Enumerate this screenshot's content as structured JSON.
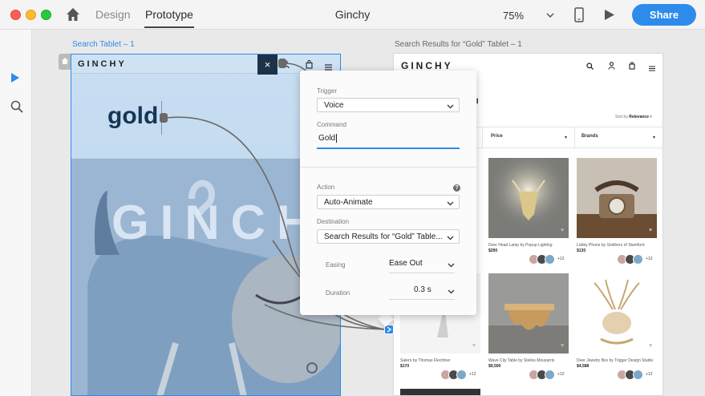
{
  "window": {
    "tabs": [
      {
        "label": "Design",
        "active": false
      },
      {
        "label": "Prototype",
        "active": true
      }
    ],
    "title": "Ginchy",
    "zoom": "75%",
    "share_label": "Share"
  },
  "artboards": {
    "tablet": {
      "label": "Search Tablet – 1",
      "logo": "GINCHY",
      "close_glyph": "×",
      "query": "gold",
      "hero_brand": "GINCHY"
    },
    "results": {
      "label": "Search Results for “Gold” Tablet – 1",
      "logo": "GINCHY",
      "heading_fragment": "d",
      "sort_prefix": "Sort by",
      "sort_value": "Relevance",
      "filters": [
        "Price",
        "Brands"
      ],
      "cards": [
        {
          "title": "Deer Head Lamp by Popup Lighting",
          "price": "$290",
          "more": "+12"
        },
        {
          "title": "Lobby Phone by Smithers of Stamford",
          "price": "$130",
          "more": "+12"
        },
        {
          "title": "Salero by Thomas Flechtner",
          "price": "$170",
          "more": "+12"
        },
        {
          "title": "Wave City Table by Stelios Mousarris",
          "price": "$9,500",
          "more": "+12"
        },
        {
          "title": "Deer Jewelry Box by Trigger Design Studio",
          "price": "$4,588",
          "more": "+12"
        }
      ]
    }
  },
  "popover": {
    "trigger_label": "Trigger",
    "trigger_value": "Voice",
    "command_label": "Command",
    "command_value": "Gold",
    "action_label": "Action",
    "help_glyph": "?",
    "action_value": "Auto-Animate",
    "destination_label": "Destination",
    "destination_value": "Search Results for “Gold” Table...",
    "easing_label": "Easing",
    "easing_value": "Ease Out",
    "duration_label": "Duration",
    "duration_value": "0.3 s"
  },
  "colors": {
    "accent": "#2d8ceb",
    "close_button": "#1d3247"
  }
}
